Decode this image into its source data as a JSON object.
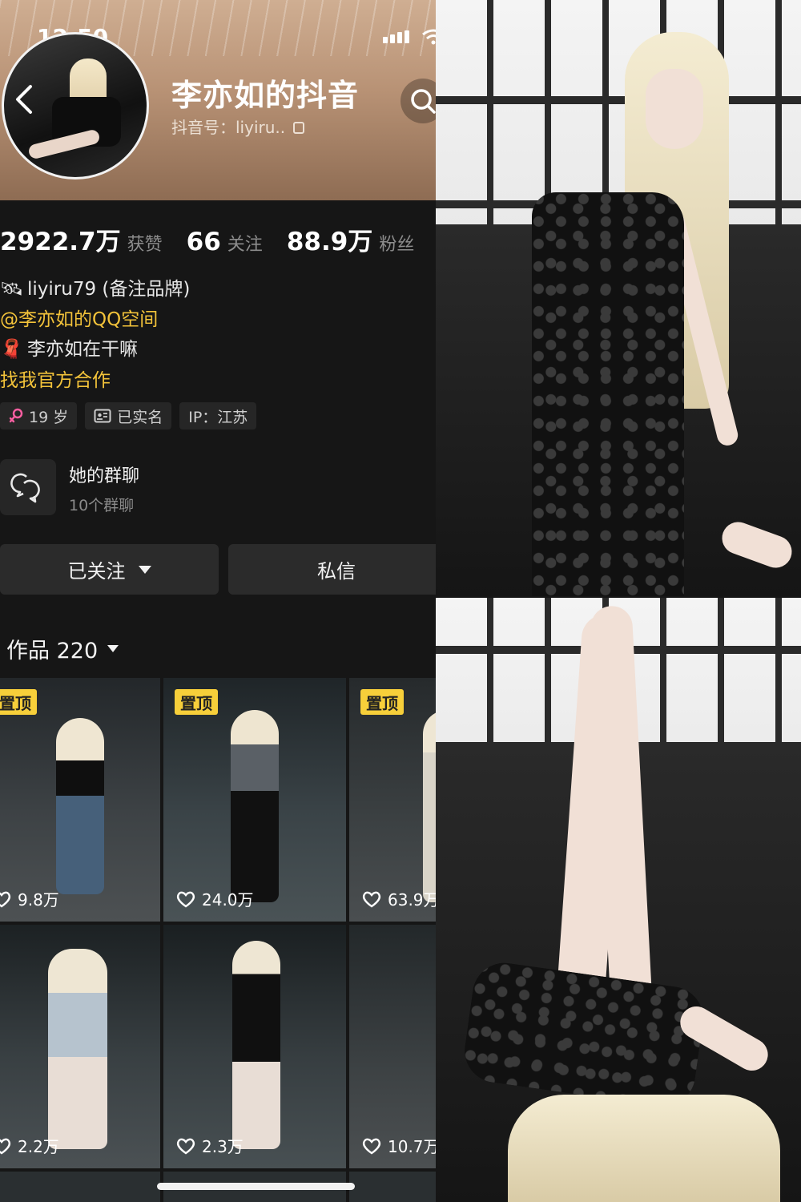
{
  "status_bar": {
    "time": "12:50"
  },
  "profile": {
    "name": "李亦如的抖音",
    "douyin_id": "抖音号：liyiru..",
    "stats": [
      {
        "value": "2922.7万",
        "label": "获赞"
      },
      {
        "value": "66",
        "label": "关注"
      },
      {
        "value": "88.9万",
        "label": "粉丝"
      }
    ],
    "bio": [
      {
        "emoji": "🛰",
        "text": "liyiru79 (备注品牌)"
      },
      {
        "emoji": "",
        "text": "@李亦如的QQ空间"
      },
      {
        "emoji": "🧣",
        "text": "李亦如在干嘛"
      },
      {
        "emoji": "",
        "text": "找我官方合作"
      }
    ],
    "tags": [
      {
        "icon": "female-icon",
        "text": "19 岁"
      },
      {
        "icon": "id-card-icon",
        "text": "已实名"
      },
      {
        "icon": "",
        "text": "IP：江苏"
      }
    ]
  },
  "group_chat": {
    "title": "她的群聊",
    "subtitle": "10个群聊"
  },
  "actions": {
    "follow_label": "已关注",
    "message_label": "私信"
  },
  "works": {
    "tab_label": "作品 220",
    "pin_label": "置顶",
    "items": [
      {
        "likes": "9.8万",
        "pinned": true
      },
      {
        "likes": "24.0万",
        "pinned": true
      },
      {
        "likes": "63.9万",
        "pinned": true
      },
      {
        "likes": "2.2万",
        "pinned": false
      },
      {
        "likes": "2.3万",
        "pinned": false
      },
      {
        "likes": "10.7万",
        "pinned": false
      }
    ]
  },
  "colors": {
    "background": "#161616",
    "accent_yellow": "#f3c33a",
    "pin_badge": "#f7cf3a",
    "button": "#2b2b2b"
  }
}
